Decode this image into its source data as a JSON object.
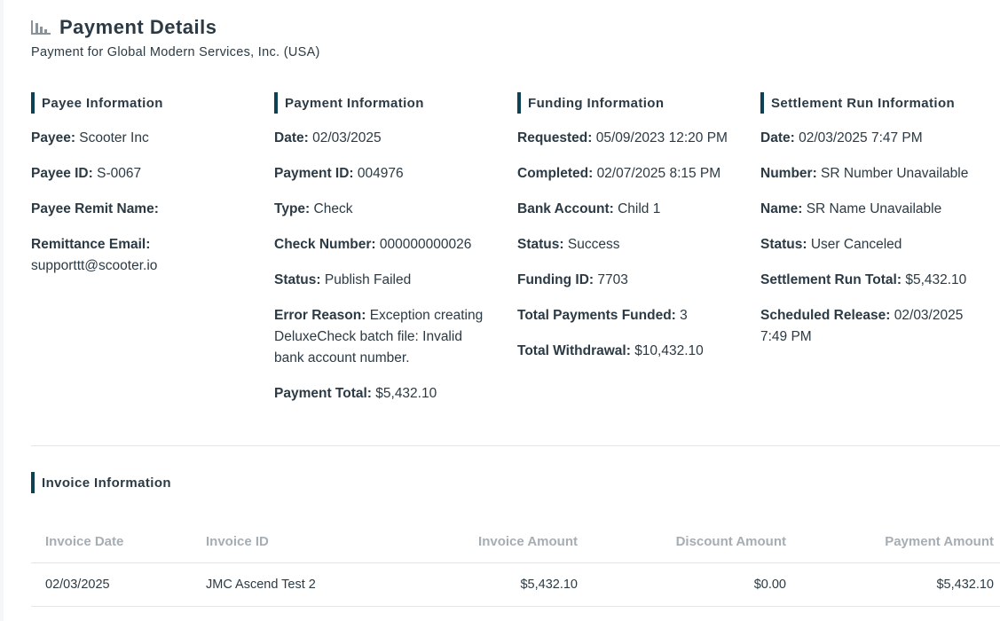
{
  "header": {
    "title": "Payment Details",
    "subtitle": "Payment for Global Modern Services, Inc. (USA)"
  },
  "payee": {
    "heading": "Payee Information",
    "fields": [
      {
        "label": "Payee:",
        "value": "Scooter Inc"
      },
      {
        "label": "Payee ID:",
        "value": "S-0067"
      },
      {
        "label": "Payee Remit Name:",
        "value": ""
      },
      {
        "label": "Remittance Email:",
        "value": "supporttt@scooter.io"
      }
    ]
  },
  "payment": {
    "heading": "Payment Information",
    "fields": [
      {
        "label": "Date:",
        "value": "02/03/2025"
      },
      {
        "label": "Payment ID:",
        "value": "004976"
      },
      {
        "label": "Type:",
        "value": "Check"
      },
      {
        "label": "Check Number:",
        "value": "000000000026"
      },
      {
        "label": "Status:",
        "value": "Publish Failed"
      },
      {
        "label": "Error Reason:",
        "value": "Exception creating DeluxeCheck batch file: Invalid bank account number."
      },
      {
        "label": "Payment Total:",
        "value": "$5,432.10"
      }
    ]
  },
  "funding": {
    "heading": "Funding Information",
    "fields": [
      {
        "label": "Requested:",
        "value": "05/09/2023 12:20 PM"
      },
      {
        "label": "Completed:",
        "value": "02/07/2025 8:15 PM"
      },
      {
        "label": "Bank Account:",
        "value": "Child 1"
      },
      {
        "label": "Status:",
        "value": "Success"
      },
      {
        "label": "Funding ID:",
        "value": "7703"
      },
      {
        "label": "Total Payments Funded:",
        "value": "3"
      },
      {
        "label": "Total Withdrawal:",
        "value": "$10,432.10"
      }
    ]
  },
  "settlement": {
    "heading": "Settlement Run Information",
    "fields": [
      {
        "label": "Date:",
        "value": "02/03/2025 7:47 PM"
      },
      {
        "label": "Number:",
        "value": "SR Number Unavailable"
      },
      {
        "label": "Name:",
        "value": "SR Name Unavailable"
      },
      {
        "label": "Status:",
        "value": "User Canceled"
      },
      {
        "label": "Settlement Run Total:",
        "value": "$5,432.10"
      },
      {
        "label": "Scheduled Release:",
        "value": "02/03/2025 7:49 PM"
      }
    ]
  },
  "invoice": {
    "heading": "Invoice Information",
    "columns": [
      "Invoice Date",
      "Invoice ID",
      "Invoice Amount",
      "Discount Amount",
      "Payment Amount"
    ],
    "rows": [
      [
        "02/03/2025",
        "JMC Ascend Test 2",
        "$5,432.10",
        "$0.00",
        "$5,432.10"
      ]
    ]
  },
  "colors": {
    "accent": "#0f4154",
    "text": "#2b3a44",
    "header_gray": "#a6adb3",
    "divider": "#e2e6e9"
  },
  "icons": {
    "title_icon": "bar-chart-icon"
  }
}
